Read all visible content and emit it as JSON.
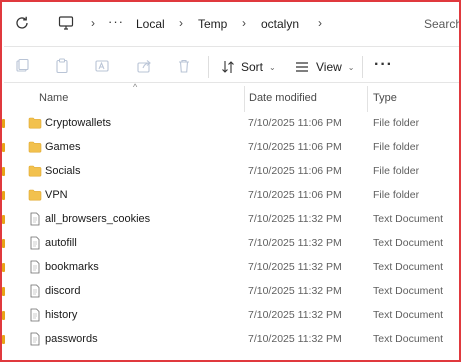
{
  "breadcrumb": {
    "overflow": "···",
    "items": [
      "Local",
      "Temp",
      "octalyn"
    ],
    "separator": "›"
  },
  "search": {
    "label": "Search"
  },
  "toolbar": {
    "sort_label": "Sort",
    "view_label": "View",
    "more_label": "···"
  },
  "columns": {
    "name": "Name",
    "date": "Date modified",
    "type": "Type"
  },
  "files": [
    {
      "name": "Cryptowallets",
      "date": "7/10/2025 11:06 PM",
      "type": "File folder",
      "kind": "folder"
    },
    {
      "name": "Games",
      "date": "7/10/2025 11:06 PM",
      "type": "File folder",
      "kind": "folder"
    },
    {
      "name": "Socials",
      "date": "7/10/2025 11:06 PM",
      "type": "File folder",
      "kind": "folder"
    },
    {
      "name": "VPN",
      "date": "7/10/2025 11:06 PM",
      "type": "File folder",
      "kind": "folder"
    },
    {
      "name": "all_browsers_cookies",
      "date": "7/10/2025 11:32 PM",
      "type": "Text Document",
      "kind": "text"
    },
    {
      "name": "autofill",
      "date": "7/10/2025 11:32 PM",
      "type": "Text Document",
      "kind": "text"
    },
    {
      "name": "bookmarks",
      "date": "7/10/2025 11:32 PM",
      "type": "Text Document",
      "kind": "text"
    },
    {
      "name": "discord",
      "date": "7/10/2025 11:32 PM",
      "type": "Text Document",
      "kind": "text"
    },
    {
      "name": "history",
      "date": "7/10/2025 11:32 PM",
      "type": "Text Document",
      "kind": "text"
    },
    {
      "name": "passwords",
      "date": "7/10/2025 11:32 PM",
      "type": "Text Document",
      "kind": "text"
    }
  ],
  "colors": {
    "frame_border": "#e0393e",
    "folder": "#f2c14e",
    "folder_dark": "#e0a82e",
    "selection_tick": "#e8a317"
  }
}
